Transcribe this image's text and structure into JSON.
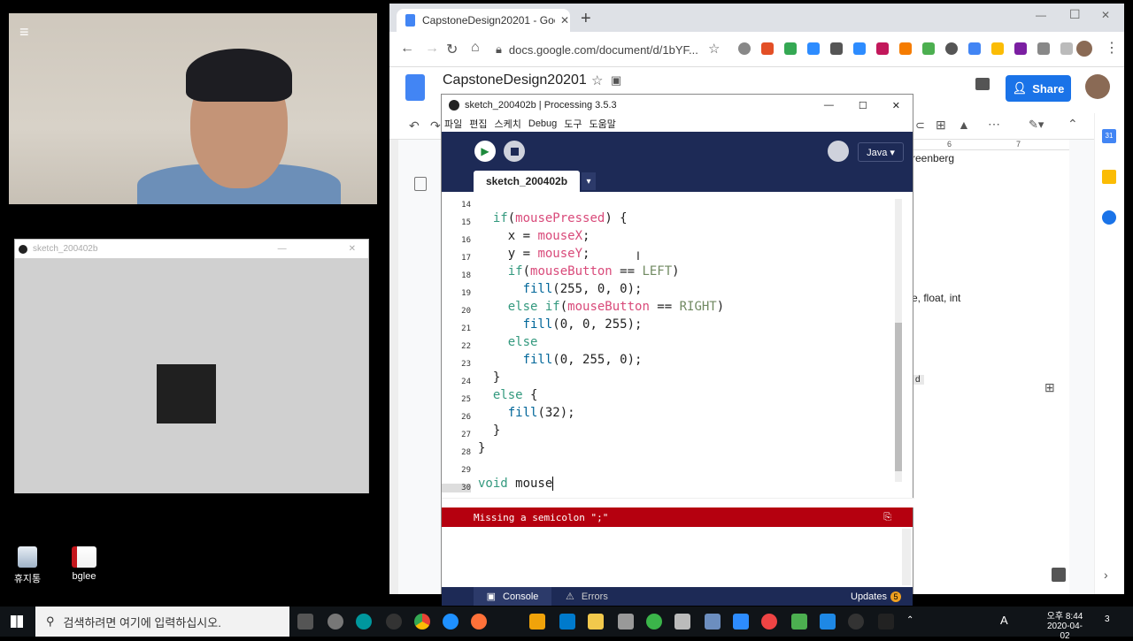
{
  "webcam": {
    "menu_glyph": "≡"
  },
  "sketch_window": {
    "title": "sketch_200402b",
    "min_glyph": "—",
    "close_glyph": "✕"
  },
  "desktop": {
    "icons": [
      {
        "label": "휴지통",
        "icon": "recycle-bin-icon"
      },
      {
        "label": "bglee",
        "icon": "folder-icon"
      }
    ]
  },
  "chrome": {
    "tab_title": "CapstoneDesign20201 - Googl",
    "url": "docs.google.com/document/d/1bYF...",
    "new_tab_glyph": "+"
  },
  "docs": {
    "title": "CapstoneDesign20201",
    "share_label": "Share",
    "fragment_top": "reenberg",
    "fragment_mid": "e, float, int",
    "fragment_low": "d",
    "ruler_6": "6",
    "ruler_7": "7",
    "calendar_badge": "31"
  },
  "processing": {
    "title": "sketch_200402b | Processing 3.5.3",
    "menu": [
      "파일",
      "편집",
      "스케치",
      "Debug",
      "도구",
      "도움말"
    ],
    "mode": "Java ▾",
    "tab": "sketch_200402b",
    "tab_arrow": "▾",
    "lines": [
      {
        "n": "14",
        "code": ""
      },
      {
        "n": "15",
        "code": "  if(mousePressed) {"
      },
      {
        "n": "16",
        "code": "    x = mouseX;"
      },
      {
        "n": "17",
        "code": "    y = mouseY;"
      },
      {
        "n": "18",
        "code": "    if(mouseButton == LEFT)"
      },
      {
        "n": "19",
        "code": "      fill(255, 0, 0);"
      },
      {
        "n": "20",
        "code": "    else if(mouseButton == RIGHT)"
      },
      {
        "n": "21",
        "code": "      fill(0, 0, 255);"
      },
      {
        "n": "22",
        "code": "    else"
      },
      {
        "n": "23",
        "code": "      fill(0, 255, 0);"
      },
      {
        "n": "24",
        "code": "  }"
      },
      {
        "n": "25",
        "code": "  else {"
      },
      {
        "n": "26",
        "code": "    fill(32);"
      },
      {
        "n": "27",
        "code": "  }"
      },
      {
        "n": "28",
        "code": "}"
      },
      {
        "n": "29",
        "code": ""
      },
      {
        "n": "30",
        "code": "void mouse"
      }
    ],
    "error": "Missing a semicolon \";\"",
    "console_tab": "Console",
    "errors_tab": "Errors",
    "updates_label": "Updates",
    "updates_count": "5"
  },
  "taskbar": {
    "search_placeholder": "검색하려면 여기에 입력하십시오.",
    "time_ampm": "오후 8:44",
    "date": "2020-04-02",
    "ime": "A",
    "notif_count": "3"
  }
}
